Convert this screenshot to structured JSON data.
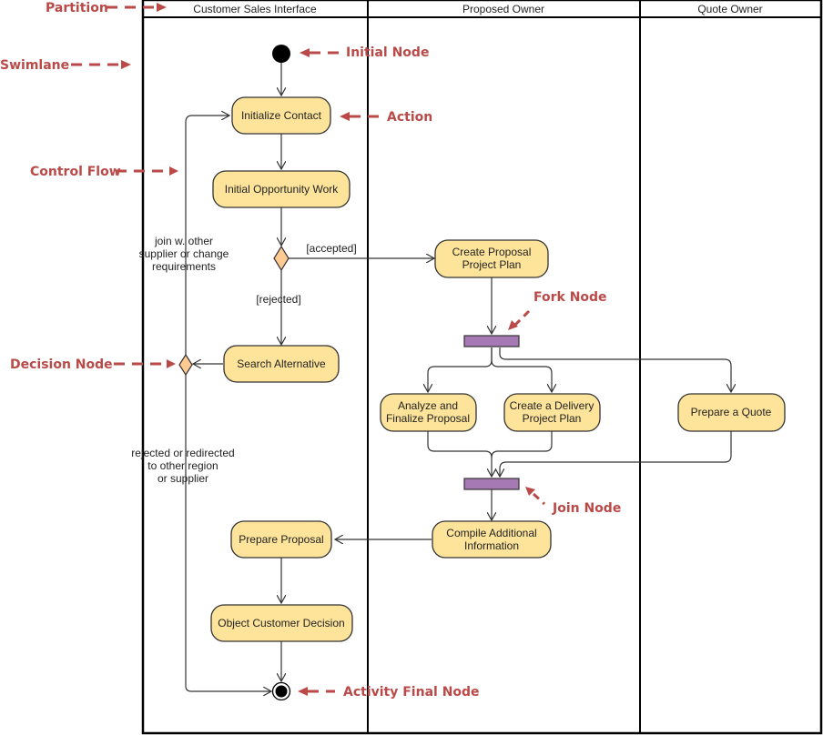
{
  "diagram": {
    "type": "UML Activity Diagram",
    "partitions": [
      {
        "id": "customer",
        "title": "Customer Sales Interface"
      },
      {
        "id": "proposed",
        "title": "Proposed Owner"
      },
      {
        "id": "quote",
        "title": "Quote Owner"
      }
    ],
    "actions": {
      "initialize_contact": "Initialize Contact",
      "initial_opportunity_work": "Initial Opportunity Work",
      "search_alternative": "Search Alternative",
      "create_proposal_plan": [
        "Create Proposal",
        "Project Plan"
      ],
      "analyze_finalize": [
        "Analyze and",
        "Finalize Proposal"
      ],
      "create_delivery_plan": [
        "Create a Delivery",
        "Project Plan"
      ],
      "prepare_quote": "Prepare a Quote",
      "compile_additional": [
        "Compile Additional",
        "Information"
      ],
      "prepare_proposal": "Prepare Proposal",
      "object_customer_decision": "Object Customer Decision"
    },
    "guards": {
      "accepted": "[accepted]",
      "rejected": "[rejected]",
      "join_other": [
        "join w. other",
        "supplier or change",
        "requirements"
      ],
      "rejected_redirected": [
        "rejected or redirected",
        "to other region",
        "or supplier"
      ]
    },
    "annotations": {
      "partition": "Partition",
      "swimlane": "Swimlane",
      "initial_node": "Initial Node",
      "action": "Action",
      "control_flow": "Control Flow",
      "fork_node": "Fork Node",
      "decision_node": "Decision Node",
      "join_node": "Join Node",
      "activity_final_node": "Activity Final Node"
    },
    "colors": {
      "action_fill": "#fde49a",
      "decision_fill": "#fdca92",
      "bar_fill": "#a678b4",
      "annotation": "#b94a48"
    }
  }
}
